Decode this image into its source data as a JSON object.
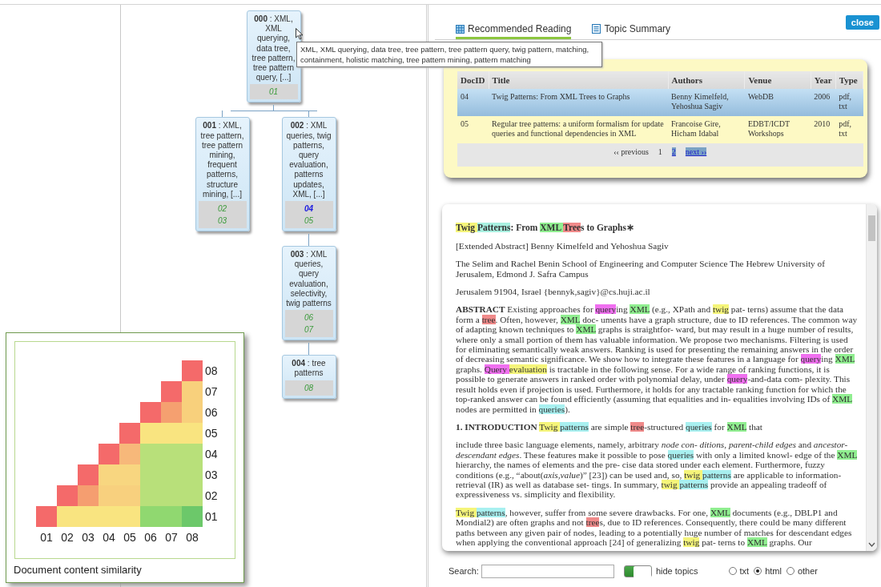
{
  "tree": {
    "title": "**000** : XML, XML querying, data tree, tree pattern, tree pattern query, [...]",
    "docs": [
      {
        "id": "01",
        "selected": false
      }
    ],
    "children": [
      {
        "title": "**001** : XML, tree pattern, tree pattern mining, frequent patterns, structure mining, [...]",
        "docs": [
          {
            "id": "02",
            "selected": false
          },
          {
            "id": "03",
            "selected": false
          }
        ]
      },
      {
        "title": "**002** : XML queries, twig patterns, query evaluation, patterns updates, XML, [...]",
        "docs": [
          {
            "id": "04",
            "selected": true
          },
          {
            "id": "05",
            "selected": false
          }
        ],
        "children": [
          {
            "title": "**003** : XML queries, query evaluation, selectivity, twig patterns",
            "docs": [
              {
                "id": "06",
                "selected": false
              },
              {
                "id": "07",
                "selected": false
              }
            ],
            "children": [
              {
                "title": "**004** : tree patterns",
                "docs": [
                  {
                    "id": "08",
                    "selected": false
                  }
                ]
              }
            ]
          }
        ]
      }
    ]
  },
  "tooltip": {
    "text": "XML, XML querying, data tree, tree pattern, tree pattern query, twig pattern, matching, containment, holistic matching, tree pattern mining, pattern matching"
  },
  "similarity": {
    "caption": "Document content similarity",
    "x_labels": [
      "01",
      "02",
      "03",
      "04",
      "05",
      "06",
      "07",
      "08"
    ],
    "rows": [
      {
        "label": "08",
        "cells": [
          {
            "color": "#f46a6a"
          }
        ]
      },
      {
        "label": "07",
        "cells": [
          {
            "color": "#f46a6a"
          },
          {
            "color": "#f8d07c"
          }
        ]
      },
      {
        "label": "06",
        "cells": [
          {
            "color": "#f46a6a"
          },
          {
            "color": "#f5a070"
          },
          {
            "color": "#f8d07c"
          }
        ]
      },
      {
        "label": "05",
        "cells": [
          {
            "color": "#f46a6a"
          },
          {
            "color": "#f9e480"
          },
          {
            "color": "#f9e480"
          },
          {
            "color": "#f9e480"
          }
        ]
      },
      {
        "label": "04",
        "cells": [
          {
            "color": "#f46a6a"
          },
          {
            "color": "#f7b87a"
          },
          {
            "color": "#b8e07a"
          },
          {
            "color": "#b8e07a"
          },
          {
            "color": "#b8e07a"
          }
        ]
      },
      {
        "label": "03",
        "cells": [
          {
            "color": "#f46a6a"
          },
          {
            "color": "#f8d680"
          },
          {
            "color": "#f8d680"
          },
          {
            "color": "#b8e07a"
          },
          {
            "color": "#b8e07a"
          },
          {
            "color": "#b8e07a"
          }
        ]
      },
      {
        "label": "02",
        "cells": [
          {
            "color": "#f46a6a"
          },
          {
            "color": "#f59e70"
          },
          {
            "color": "#f8d07e"
          },
          {
            "color": "#f8d07e"
          },
          {
            "color": "#b8e07a"
          },
          {
            "color": "#b8e07a"
          },
          {
            "color": "#b8e07a"
          }
        ]
      },
      {
        "label": "01",
        "cells": [
          {
            "color": "#f46a6a"
          },
          {
            "color": "#f9e480"
          },
          {
            "color": "#f9e480"
          },
          {
            "color": "#f9e480"
          },
          {
            "color": "#f9e480"
          },
          {
            "color": "#90d870"
          },
          {
            "color": "#90d870"
          },
          {
            "color": "#6cc86a"
          }
        ]
      }
    ]
  },
  "tabs": [
    {
      "label": "Recommended Reading",
      "kind": "grid",
      "selected": true
    },
    {
      "label": "Topic Summary",
      "kind": "list",
      "selected": false
    }
  ],
  "close_button": "close",
  "table": {
    "columns": [
      "DocID",
      "Title",
      "Authors",
      "Venue",
      "Year",
      "Type"
    ],
    "rows": [
      {
        "selected": true,
        "cells": [
          "04",
          "Twig Patterns: From XML Trees to Graphs",
          "Benny Kimelfeld, Yehoshua Sagiv",
          "WebDB",
          "2006",
          "pdf, txt"
        ]
      },
      {
        "selected": false,
        "cells": [
          "05",
          "Regular tree patterns: a uniform formalism for update queries and functional dependencies in XML",
          "Francoise Gire, Hicham Idabal",
          "EDBT/ICDT Workshops",
          "2010",
          "pdf, txt"
        ]
      }
    ],
    "pagination": [
      {
        "label": "‹‹ previous",
        "kind": "plain"
      },
      {
        "label": "1",
        "kind": "current"
      },
      {
        "label": "2",
        "kind": "link"
      },
      {
        "label": "next ››",
        "kind": "link"
      }
    ]
  },
  "document": {
    "paragraphs": [
      {
        "kind": "title",
        "segments": [
          {
            "text": "Twig ",
            "color": "#f5f57a"
          },
          {
            "text": "Patterns",
            "color": "#a8f0e0"
          },
          {
            "text": ": From "
          },
          {
            "text": "XML ",
            "color": "#90ee90"
          },
          {
            "text": "Tree",
            "color": "#f08a8a"
          },
          {
            "text": "s to Graphs∗"
          }
        ]
      },
      {
        "kind": "text",
        "segments": [
          {
            "text": "[Extended Abstract] Benny Kimelfeld and Yehoshua Sagiv"
          }
        ]
      },
      {
        "kind": "text",
        "segments": [
          {
            "text": "The Selim and Rachel Benin School of Engineering and Computer Science The Hebrew University of Jerusalem, Edmond J. Safra Campus"
          }
        ]
      },
      {
        "kind": "text",
        "segments": [
          {
            "text": "Jerusalem 91904, Israel {bennyk,sagiv}@cs.huji.ac.il"
          }
        ]
      },
      {
        "kind": "text",
        "segments": [
          {
            "text": "**ABSTRACT** Existing approaches for "
          },
          {
            "text": "query",
            "color": "#f070f0"
          },
          {
            "text": "ing "
          },
          {
            "text": "XML",
            "color": "#90ee90"
          },
          {
            "text": " (e.g., XPath and "
          },
          {
            "text": "twig",
            "color": "#f5f57a"
          },
          {
            "text": " pat- terns) assume that the data form a "
          },
          {
            "text": "tree",
            "color": "#f08a8a"
          },
          {
            "text": ". Often, however, "
          },
          {
            "text": "XML",
            "color": "#90ee90"
          },
          {
            "text": " doc- uments have a graph structure, due to ID references. The common way of adapting known techniques to "
          },
          {
            "text": "XML",
            "color": "#90ee90"
          },
          {
            "text": " graphs is straightfor- ward, but may result in a huge number of results, where only a small portion of them has valuable information. We propose two mechanisms. Filtering is used for eliminating semantically weak answers. Ranking is used for presenting the remaining answers in the order of decreasing semantic significance. We show how to integrate these features in a language for "
          },
          {
            "text": "query",
            "color": "#f070f0"
          },
          {
            "text": "ing "
          },
          {
            "text": "XML",
            "color": "#90ee90"
          },
          {
            "text": " graphs. "
          },
          {
            "text": "Query ",
            "color": "#f070f0"
          },
          {
            "text": "evaluation",
            "color": "#f5f57a"
          },
          {
            "text": " is tractable in the following sense. For a wide range of ranking functions, it is possible to generate answers in ranked order with polynomial delay, under "
          },
          {
            "text": "query",
            "color": "#f070f0"
          },
          {
            "text": "-and-data com- plexity. This result holds even if projection is used. Furthermore, it holds for any tractable ranking function for which the top-ranked answer can be found efficiently (assuming that equalities and in- equalities involving IDs of "
          },
          {
            "text": "XML",
            "color": "#90ee90"
          },
          {
            "text": " nodes are permitted in "
          },
          {
            "text": "queries",
            "color": "#a8f0f0"
          },
          {
            "text": ")."
          }
        ]
      },
      {
        "kind": "text",
        "segments": [
          {
            "text": "**1. INTRODUCTION** "
          },
          {
            "text": "Twig ",
            "color": "#f5f57a"
          },
          {
            "text": "patterns",
            "color": "#a8f0f0"
          },
          {
            "text": " are simple "
          },
          {
            "text": "tree",
            "color": "#f08a8a"
          },
          {
            "text": "-structured "
          },
          {
            "text": "queries",
            "color": "#a8f0f0"
          },
          {
            "text": " for "
          },
          {
            "text": "XML",
            "color": "#90ee90"
          },
          {
            "text": " that"
          }
        ]
      },
      {
        "kind": "text",
        "segments": [
          {
            "text": "include three basic language elements, namely, arbitrary *node con- ditions*, *parent-child edges* and *ancestor-descendant edges*. These features make it possible to pose "
          },
          {
            "text": "queries",
            "color": "#a8f0f0"
          },
          {
            "text": " with only a limited knowl- edge of the "
          },
          {
            "text": "XML",
            "color": "#90ee90"
          },
          {
            "text": " hierarchy, the names of elements and the pre- cise data stored under each element. Furthermore, fuzzy conditions (e.g., “about(*axis,value*)” [23]) can be used and, so, "
          },
          {
            "text": "twig ",
            "color": "#f5f57a"
          },
          {
            "text": "patterns",
            "color": "#a8f0f0"
          },
          {
            "text": " are applicable to information-retrieval (IR) as well as database set- tings. In summary, "
          },
          {
            "text": "twig ",
            "color": "#f5f57a"
          },
          {
            "text": "patterns",
            "color": "#a8f0f0"
          },
          {
            "text": " provide an appealing tradeoff of expressiveness vs. simplicity and flexibility."
          }
        ]
      },
      {
        "kind": "text",
        "segments": [
          {
            "text": "Twig ",
            "color": "#f5f57a"
          },
          {
            "text": "patterns",
            "color": "#a8f0f0"
          },
          {
            "text": ", however, suffer from some severe drawbacks. For one, "
          },
          {
            "text": "XML",
            "color": "#90ee90"
          },
          {
            "text": " documents (e.g., DBLP1 and Mondial2) are often graphs and not "
          },
          {
            "text": "tree",
            "color": "#f08a8a"
          },
          {
            "text": "s, due to ID references. Consequently, there could be many different paths between any given pair of nodes, leading to a potentially huge number of matches for descendant edges when applying the conventional approach [24] of generalizing "
          },
          {
            "text": "twig",
            "color": "#f5f57a"
          },
          {
            "text": " pat- terns to "
          },
          {
            "text": "XML",
            "color": "#90ee90"
          },
          {
            "text": " graphs. Our"
          }
        ]
      }
    ]
  },
  "search": {
    "label": "Search:"
  },
  "toggle": {
    "label": "hide topics",
    "on": true
  },
  "formats": [
    {
      "label": "txt",
      "selected": false
    },
    {
      "label": "html",
      "selected": true
    },
    {
      "label": "other",
      "selected": false
    }
  ]
}
